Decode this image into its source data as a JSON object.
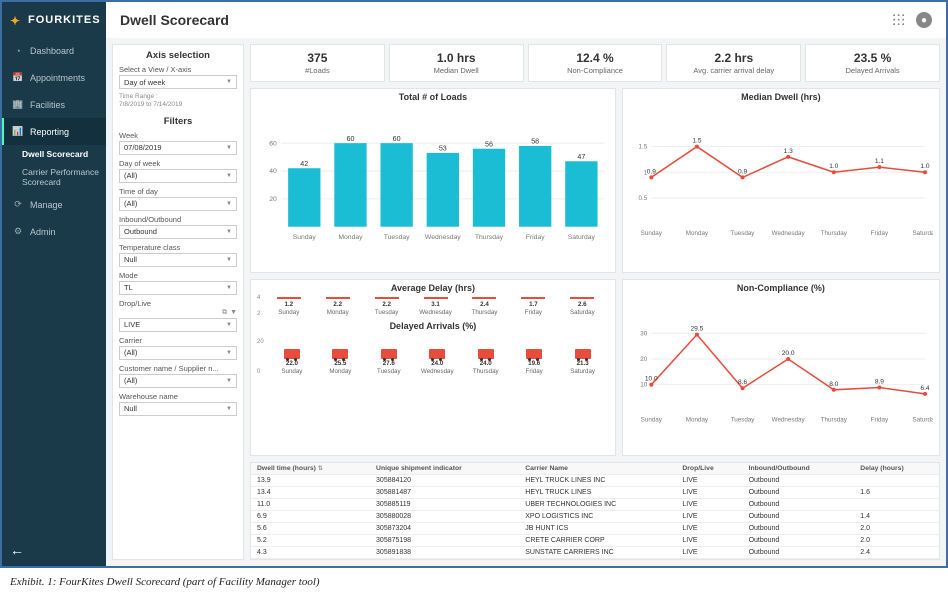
{
  "brand": "FOURKITES",
  "page_title": "Dwell Scorecard",
  "sidebar": {
    "items": [
      {
        "icon": "◔",
        "label": "Dashboard"
      },
      {
        "icon": "📅",
        "label": "Appointments"
      },
      {
        "icon": "🏢",
        "label": "Facilities"
      },
      {
        "icon": "📊",
        "label": "Reporting"
      },
      {
        "icon": "⟳",
        "label": "Manage"
      },
      {
        "icon": "⚙",
        "label": "Admin"
      }
    ],
    "subitems": [
      {
        "label": "Dwell Scorecard"
      },
      {
        "label": "Carrier Performance Scorecard"
      }
    ]
  },
  "axis": {
    "heading": "Axis selection",
    "view_label": "Select a View / X-axis",
    "view_value": "Day of week",
    "timerange_label": "Time Range :",
    "timerange_value": "7/8/2019 to 7/14/2019"
  },
  "filters": {
    "heading": "Filters",
    "items": [
      {
        "label": "Week",
        "value": "07/08/2019"
      },
      {
        "label": "Day of week",
        "value": "(All)"
      },
      {
        "label": "Time of day",
        "value": "(All)"
      },
      {
        "label": "Inbound/Outbound",
        "value": "Outbound"
      },
      {
        "label": "Temperature class",
        "value": "Null"
      },
      {
        "label": "Mode",
        "value": "TL"
      },
      {
        "label": "Drop/Live",
        "value": "LIVE",
        "icons": true
      },
      {
        "label": "Carrier",
        "value": "(All)"
      },
      {
        "label": "Customer name / Supplier n...",
        "value": "(All)"
      },
      {
        "label": "Warehouse name",
        "value": "Null"
      }
    ]
  },
  "kpis": [
    {
      "value": "375",
      "label": "#Loads"
    },
    {
      "value": "1.0 hrs",
      "label": "Median Dwell"
    },
    {
      "value": "12.4 %",
      "label": "Non-Compliance"
    },
    {
      "value": "2.2 hrs",
      "label": "Avg. carrier arrival delay"
    },
    {
      "value": "23.5 %",
      "label": "Delayed Arrivals"
    }
  ],
  "chart_data": [
    {
      "type": "bar",
      "title": "Total # of Loads",
      "categories": [
        "Sunday",
        "Monday",
        "Tuesday",
        "Wednesday",
        "Thursday",
        "Friday",
        "Saturday"
      ],
      "values": [
        42,
        60,
        60,
        53,
        56,
        58,
        47
      ],
      "ylim": [
        0,
        60
      ],
      "yticks": [
        20,
        40,
        60
      ],
      "color": "#1bbdd4"
    },
    {
      "type": "line",
      "title": "Median Dwell (hrs)",
      "categories": [
        "Sunday",
        "Monday",
        "Tuesday",
        "Wednesday",
        "Thursday",
        "Friday",
        "Saturday"
      ],
      "values": [
        0.9,
        1.5,
        0.9,
        1.3,
        1.0,
        1.1,
        1.0
      ],
      "ylim": [
        0,
        1.5
      ],
      "yticks": [
        0.5,
        1.0,
        1.5
      ],
      "color": "#e74c3c"
    },
    {
      "type": "bar",
      "title": "Average Delay (hrs)",
      "categories": [
        "Sunday",
        "Monday",
        "Tuesday",
        "Wednesday",
        "Thursday",
        "Friday",
        "Saturday"
      ],
      "values": [
        1.2,
        2.2,
        2.2,
        3.1,
        2.4,
        1.7,
        2.6
      ],
      "ylim": [
        0,
        4
      ],
      "color": "#e74c3c"
    },
    {
      "type": "bar",
      "title": "Delayed Arrivals (%)",
      "categories": [
        "Sunday",
        "Monday",
        "Tuesday",
        "Wednesday",
        "Thursday",
        "Friday",
        "Saturday"
      ],
      "values": [
        22.0,
        25.5,
        27.6,
        24.0,
        24.0,
        19.6,
        21.3
      ],
      "ylim": [
        0,
        30
      ],
      "color": "#e74c3c"
    },
    {
      "type": "line",
      "title": "Non-Compliance (%)",
      "categories": [
        "Sunday",
        "Monday",
        "Tuesday",
        "Wednesday",
        "Thursday",
        "Friday",
        "Saturday"
      ],
      "values": [
        10.0,
        29.5,
        8.6,
        20.0,
        8.0,
        8.9,
        6.4
      ],
      "ylim": [
        0,
        30
      ],
      "yticks": [
        10,
        20,
        30
      ],
      "color": "#e74c3c"
    }
  ],
  "table": {
    "headers": [
      "Dwell time (hours)",
      "Unique shipment indicator",
      "Carrier Name",
      "Drop/Live",
      "Inbound/Outbound",
      "Delay (hours)"
    ],
    "rows": [
      [
        "13.9",
        "305884120",
        "HEYL TRUCK LINES INC",
        "LIVE",
        "Outbound",
        ""
      ],
      [
        "13.4",
        "305881487",
        "HEYL TRUCK LINES",
        "LIVE",
        "Outbound",
        "1.6"
      ],
      [
        "11.0",
        "305885119",
        "UBER TECHNOLOGIES INC",
        "LIVE",
        "Outbound",
        ""
      ],
      [
        "6.9",
        "305880028",
        "XPO LOGISTICS INC",
        "LIVE",
        "Outbound",
        "1.4"
      ],
      [
        "5.6",
        "305873204",
        "JB HUNT ICS",
        "LIVE",
        "Outbound",
        "2.0"
      ],
      [
        "5.2",
        "305875198",
        "CRETE CARRIER CORP",
        "LIVE",
        "Outbound",
        "2.0"
      ],
      [
        "4.3",
        "305891838",
        "SUNSTATE CARRIERS INC",
        "LIVE",
        "Outbound",
        "2.4"
      ]
    ]
  },
  "caption": "Exhibit. 1: FourKites Dwell Scorecard (part of Facility Manager tool)"
}
